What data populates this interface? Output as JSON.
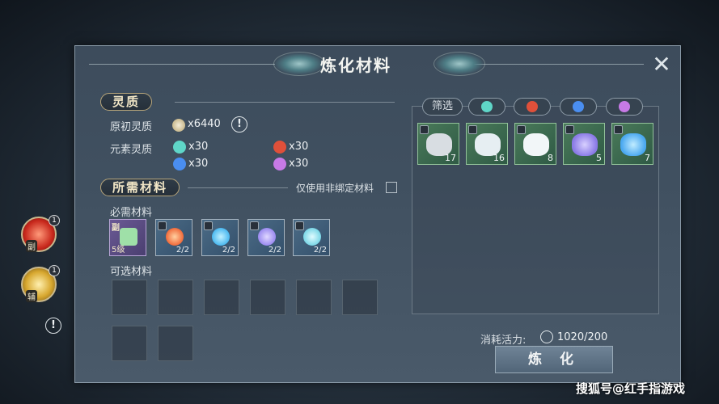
{
  "window": {
    "title": "炼化材料",
    "close_glyph": "✕"
  },
  "spirit": {
    "section_label": "灵质",
    "primal_label": "原初灵质",
    "primal_value": "x6440",
    "info_glyph": "!",
    "element_label": "元素灵质",
    "elements": [
      {
        "icon": "wind-icon",
        "color": "#5fd6c8",
        "value": "x30"
      },
      {
        "icon": "fire-icon",
        "color": "#e0503a",
        "value": "x30"
      },
      {
        "icon": "water-icon",
        "color": "#4a8ef0",
        "value": "x30"
      },
      {
        "icon": "lightning-icon",
        "color": "#c77ae6",
        "value": "x30"
      }
    ]
  },
  "required": {
    "section_label": "所需材料",
    "unbound_only_label": "仅使用非绑定材料",
    "must_label": "必需材料",
    "must_items": [
      {
        "name": "lantern-material",
        "tag": "副",
        "level": "5级",
        "color": "#9fe0a8",
        "rarity": "purple"
      },
      {
        "name": "fire-essence",
        "count": "2/2",
        "color": "#f06a3a",
        "rarity": "blue"
      },
      {
        "name": "water-essence",
        "count": "2/2",
        "color": "#4ab8f0",
        "rarity": "blue"
      },
      {
        "name": "lightning-essence",
        "count": "2/2",
        "color": "#9a8af0",
        "rarity": "blue"
      },
      {
        "name": "wind-essence",
        "count": "2/2",
        "color": "#7ad6e6",
        "rarity": "blue"
      }
    ],
    "optional_label": "可选材料"
  },
  "inventory": {
    "filter_label": "筛选",
    "filters": [
      {
        "icon": "wind-icon",
        "color": "#5fd6c8"
      },
      {
        "icon": "fire-icon",
        "color": "#e0503a"
      },
      {
        "icon": "water-icon",
        "color": "#4a8ef0"
      },
      {
        "icon": "lightning-icon",
        "color": "#c77ae6"
      }
    ],
    "items": [
      {
        "name": "stone-material",
        "count": "17",
        "color": "#d8dde2"
      },
      {
        "name": "crystal-material",
        "count": "16",
        "color": "#e6eef2"
      },
      {
        "name": "ice-block-material",
        "count": "8",
        "color": "#f2f6f8"
      },
      {
        "name": "lightning-orb-material",
        "count": "5",
        "color": "#8a7ae6"
      },
      {
        "name": "water-orb-material",
        "count": "7",
        "color": "#4aa8f0"
      }
    ]
  },
  "cost": {
    "label": "消耗活力:",
    "value": "1020/200"
  },
  "refine_button": "炼 化",
  "side": {
    "top_badge": "1",
    "top_caption": "副",
    "bottom_badge": "1",
    "bottom_caption": "辅",
    "alert_glyph": "!"
  },
  "watermark": "搜狐号@红手指游戏"
}
